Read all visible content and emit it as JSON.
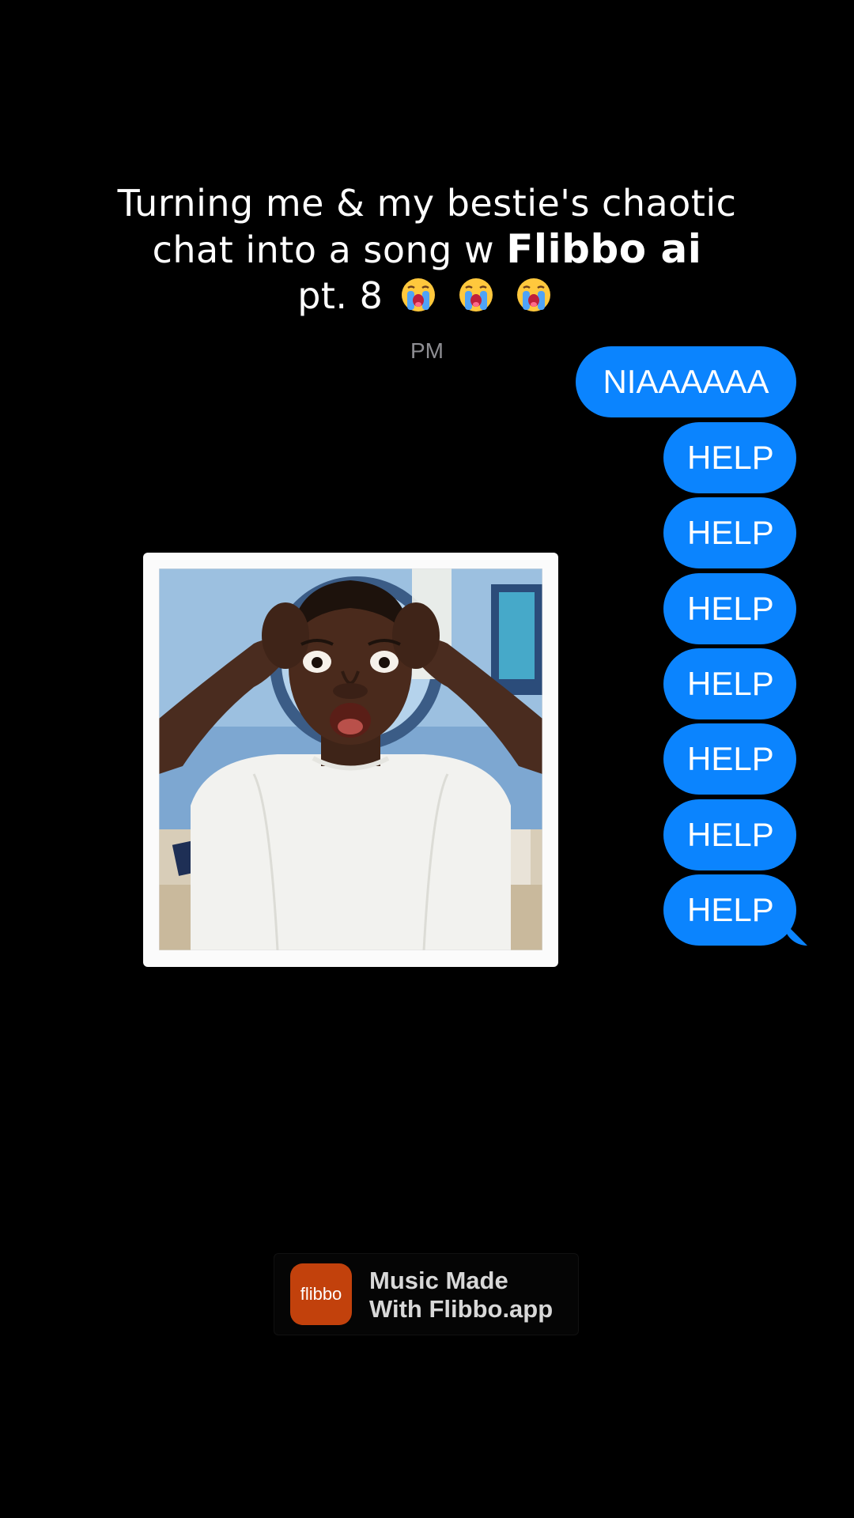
{
  "caption": {
    "line1": "Turning me & my bestie's chaotic",
    "line2_prefix": "chat into a song w ",
    "line2_brand": "Flibbo ai",
    "line3": "pt. 8",
    "emoji_icons": [
      "loudly-crying-face",
      "loudly-crying-face",
      "loudly-crying-face"
    ]
  },
  "conversation": {
    "timestamp": "PM",
    "messages": [
      {
        "text": "NIAAAAAA",
        "sender": "me"
      },
      {
        "text": "HELP",
        "sender": "me"
      },
      {
        "text": "HELP",
        "sender": "me"
      },
      {
        "text": "HELP",
        "sender": "me"
      },
      {
        "text": "HELP",
        "sender": "me"
      },
      {
        "text": "HELP",
        "sender": "me"
      },
      {
        "text": "HELP",
        "sender": "me"
      },
      {
        "text": "HELP",
        "sender": "me"
      }
    ],
    "bubble_color": "#0b84fe"
  },
  "photo": {
    "description_icon": "shocked-man-photo"
  },
  "promo": {
    "logo_text": "flibbo",
    "line1": "Music Made",
    "line2": "With Flibbo.app",
    "logo_color": "#c2410c"
  }
}
